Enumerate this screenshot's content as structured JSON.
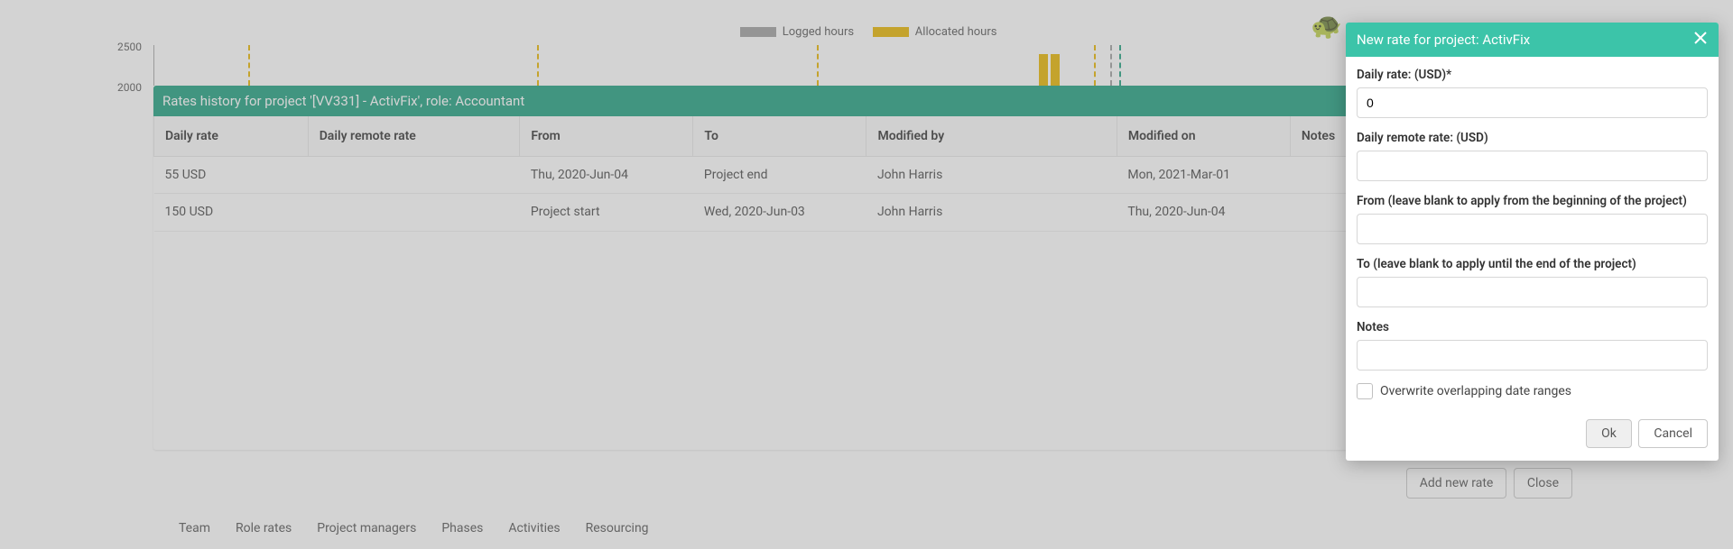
{
  "chart": {
    "y_ticks": [
      "2500",
      "2000"
    ],
    "legend": {
      "logged": "Logged hours",
      "allocated": "Allocated hours"
    }
  },
  "rates_panel": {
    "title": "Rates history for project '[VV331] - ActivFix', role: Accountant",
    "columns": {
      "daily_rate": "Daily rate",
      "daily_remote_rate": "Daily remote rate",
      "from": "From",
      "to": "To",
      "modified_by": "Modified by",
      "modified_on": "Modified on",
      "notes": "Notes"
    },
    "rows": [
      {
        "daily_rate": "55 USD",
        "daily_remote_rate": "",
        "from": "Thu, 2020-Jun-04",
        "to": "Project end",
        "modified_by": "John Harris",
        "modified_on": "Mon, 2021-Mar-01",
        "notes": ""
      },
      {
        "daily_rate": "150 USD",
        "daily_remote_rate": "",
        "from": "Project start",
        "to": "Wed, 2020-Jun-03",
        "modified_by": "John Harris",
        "modified_on": "Thu, 2020-Jun-04",
        "notes": ""
      }
    ],
    "buttons": {
      "add": "Add new rate",
      "close": "Close"
    }
  },
  "tabs": {
    "team": "Team",
    "role_rates": "Role rates",
    "project_managers": "Project managers",
    "phases": "Phases",
    "activities": "Activities",
    "resourcing": "Resourcing"
  },
  "modal": {
    "title": "New rate for project: ActivFix",
    "labels": {
      "daily_rate": "Daily rate: (USD)*",
      "daily_remote_rate": "Daily remote rate: (USD)",
      "from": "From (leave blank to apply from the beginning of the project)",
      "to": "To (leave blank to apply until the end of the project)",
      "notes": "Notes",
      "overwrite": "Overwrite overlapping date ranges"
    },
    "values": {
      "daily_rate": "0",
      "daily_remote_rate": "",
      "from": "",
      "to": "",
      "notes": ""
    },
    "buttons": {
      "ok": "Ok",
      "cancel": "Cancel"
    }
  }
}
